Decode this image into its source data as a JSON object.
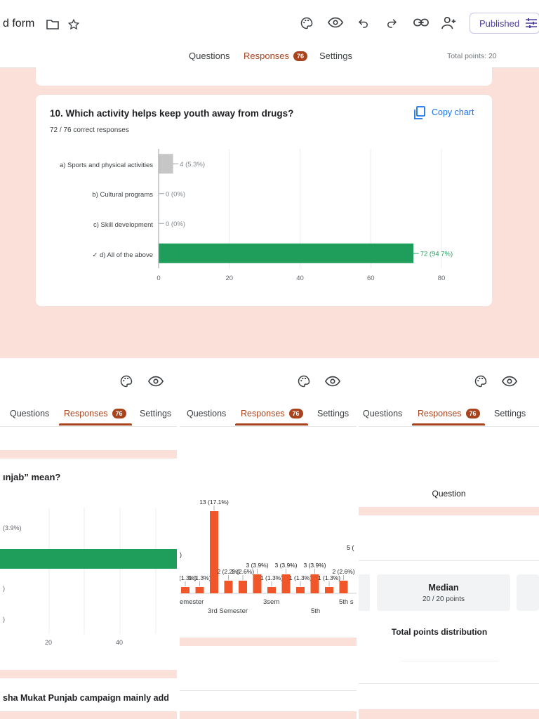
{
  "header": {
    "form_title": "d form",
    "published_label": "Published",
    "icons": [
      "folder-icon",
      "star-icon",
      "palette-icon",
      "eye-icon",
      "undo-icon",
      "redo-icon",
      "link-icon",
      "add-person-icon",
      "tune-icon"
    ]
  },
  "tabs": {
    "questions": "Questions",
    "responses": "Responses",
    "responses_count": "76",
    "settings": "Settings",
    "total_points": "Total points: 20"
  },
  "question": {
    "title": "10. Which activity helps keep youth away from drugs?",
    "correct_responses": "72 / 76 correct responses",
    "copy_chart_label": "Copy chart"
  },
  "chart_data": [
    {
      "type": "bar",
      "orientation": "horizontal",
      "categories": [
        "a) Sports and physical activities",
        "b) Cultural programs",
        "c) Skill development",
        "✓ d) All of the above"
      ],
      "values": [
        4,
        0,
        0,
        72
      ],
      "value_labels": [
        "4 (5.3%)",
        "0 (0%)",
        "0 (0%)",
        "72 (94 7%)"
      ],
      "correct_index": 3,
      "xticks": [
        "0",
        "20",
        "40",
        "60",
        "80"
      ],
      "xlim": [
        0,
        80
      ],
      "grid": true,
      "colors": {
        "correct": "#1e9e5a",
        "other": "#c6c6c6"
      }
    },
    {
      "type": "bar",
      "orientation": "horizontal",
      "partial": true,
      "value_labels": [
        "(3.9%)"
      ],
      "xticks": [
        "20",
        "40"
      ],
      "colors": {
        "bar": "#1e9e5a"
      }
    },
    {
      "type": "bar",
      "partial": true,
      "values": [
        1,
        1,
        13,
        2,
        2,
        3,
        1,
        3,
        1,
        3,
        1,
        2
      ],
      "data_labels": [
        "1 (1.3%)",
        "1 (1.3%)",
        "13 (17.1%)",
        "2 (2.2%)",
        "2 (2.6%)",
        "3 (3.9%)",
        "1 (1.3%)",
        "3 (3.9%)",
        "1 (1.3%)",
        "3 (3.9%)",
        "1 (1.3%)",
        "2 (2.6%)"
      ],
      "xticks": [
        "emester",
        "3rd Semester",
        "3sem",
        "5th",
        "5th s"
      ],
      "extra_labels": [
        ")",
        "5 ("
      ],
      "colors": {
        "bar": "#f0562a"
      }
    }
  ],
  "panel1": {
    "palette_icon": "palette-icon",
    "eye_icon": "eye-icon",
    "question_fragment": "ınjab” mean?",
    "next_question_fragment": "sha Mukat Punjab campaign mainly add",
    "left_labels": [
      ")",
      ")"
    ]
  },
  "panel3": {
    "question_label": "Question",
    "median_title": "Median",
    "median_value": "20 / 20 points",
    "distribution_title": "Total points distribution"
  }
}
